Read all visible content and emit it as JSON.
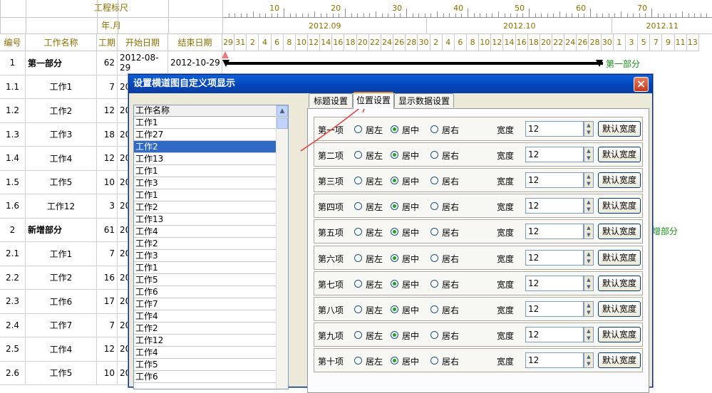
{
  "header": {
    "scale_label": "工程标尺",
    "date_label": "年.月",
    "scale_numbers": [
      "10",
      "20",
      "30",
      "40",
      "50",
      "60",
      "70"
    ],
    "months": [
      "2012.09",
      "2012.10",
      "2012.11"
    ],
    "columns": [
      "编号",
      "工作名称",
      "工期",
      "开始日期",
      "结束日期"
    ],
    "days": [
      "29",
      "31",
      "2",
      "4",
      "6",
      "8",
      "10",
      "12",
      "14",
      "16",
      "18",
      "20",
      "22",
      "24",
      "26",
      "28",
      "30",
      "2",
      "4",
      "6",
      "8",
      "10",
      "12",
      "14",
      "16",
      "18",
      "20",
      "22",
      "24",
      "26",
      "28",
      "30",
      "1",
      "3",
      "5",
      "7",
      "9",
      "11",
      "13"
    ]
  },
  "rows": [
    {
      "id": "1",
      "name": "第一部分",
      "dur": "62",
      "start": "2012-08-29",
      "end": "2012-10-29",
      "bold": true
    },
    {
      "id": "1.1",
      "name": "工作1",
      "dur": "7",
      "start": "20",
      "end": "",
      "bold": false
    },
    {
      "id": "1.2",
      "name": "工作2",
      "dur": "12",
      "start": "20",
      "end": "",
      "bold": false
    },
    {
      "id": "1.3",
      "name": "工作3",
      "dur": "18",
      "start": "20",
      "end": "",
      "bold": false
    },
    {
      "id": "1.4",
      "name": "工作4",
      "dur": "12",
      "start": "20",
      "end": "",
      "bold": false
    },
    {
      "id": "1.5",
      "name": "工作5",
      "dur": "10",
      "start": "20",
      "end": "",
      "bold": false
    },
    {
      "id": "1.6",
      "name": "工作12",
      "dur": "3",
      "start": "20",
      "end": "",
      "bold": false
    },
    {
      "id": "2",
      "name": "新增部分",
      "dur": "61",
      "start": "20",
      "end": "",
      "bold": true
    },
    {
      "id": "2.1",
      "name": "工作1",
      "dur": "7",
      "start": "20",
      "end": "",
      "bold": false
    },
    {
      "id": "2.2",
      "name": "工作2",
      "dur": "16",
      "start": "20",
      "end": "",
      "bold": false
    },
    {
      "id": "2.3",
      "name": "工作6",
      "dur": "17",
      "start": "20",
      "end": "",
      "bold": false
    },
    {
      "id": "2.4",
      "name": "工作7",
      "dur": "7",
      "start": "20",
      "end": "",
      "bold": false
    },
    {
      "id": "2.5",
      "name": "工作4",
      "dur": "12",
      "start": "20",
      "end": "",
      "bold": false
    },
    {
      "id": "2.6",
      "name": "工作5",
      "dur": "10",
      "start": "20",
      "end": "",
      "bold": false
    }
  ],
  "bar_label_1": "第一部分",
  "bar_label_2": "增部分",
  "dialog": {
    "title": "设置横道图自定义项显示",
    "close": "×",
    "tabs": [
      "标题设置",
      "位置设置",
      "显示数据设置"
    ],
    "active_tab": 1,
    "list_header": "工作名称",
    "list_items": [
      "工作1",
      "工作27",
      "工作2",
      "工作13",
      "工作1",
      "工作3",
      "工作1",
      "工作2",
      "工作13",
      "工作4",
      "工作2",
      "工作3",
      "工作1",
      "工作5",
      "工作6",
      "工作7",
      "工作4",
      "工作2",
      "工作12",
      "工作4",
      "工作5",
      "工作6"
    ],
    "selected_index": 2,
    "left_label": "居左",
    "center_label": "居中",
    "right_label": "居右",
    "width_label": "宽度",
    "default_btn": "默认宽度",
    "items": [
      {
        "label": "第一项",
        "width": "12"
      },
      {
        "label": "第二项",
        "width": "12"
      },
      {
        "label": "第三项",
        "width": "12"
      },
      {
        "label": "第四项",
        "width": "12"
      },
      {
        "label": "第五项",
        "width": "12"
      },
      {
        "label": "第六项",
        "width": "12"
      },
      {
        "label": "第七项",
        "width": "12"
      },
      {
        "label": "第八项",
        "width": "12"
      },
      {
        "label": "第九项",
        "width": "12"
      },
      {
        "label": "第十项",
        "width": "12"
      }
    ],
    "alignment_selected": "center"
  }
}
